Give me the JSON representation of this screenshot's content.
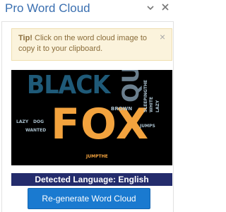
{
  "header": {
    "title": "Pro Word Cloud"
  },
  "tip": {
    "label": "Tip!",
    "text": "Click on the word cloud image to copy it to your clipboard.",
    "close": "×"
  },
  "cloud": {
    "words": {
      "black": "BLACK",
      "fox": "FOX",
      "quick": "QUICK",
      "brown": "BROWN",
      "lazy": "LAZY",
      "dog": "DOG",
      "wanted": "WANTED",
      "jumpthe": "JUMPTHE",
      "jumps": "JUMPS",
      "sleepingthe": "SLEEPINGTHE",
      "white": "WHITE",
      "small_lazy": "LAZY"
    },
    "colors": {
      "black": "#1f5a78",
      "fox": "#f3a33e",
      "quick": "#6b7f8e",
      "brown": "#a9bfcc",
      "small": "#a9bfcc",
      "jumpthe": "#f3a33e"
    }
  },
  "language": {
    "text": "Detected Language: English"
  },
  "regenerate": {
    "label": "Re-generate Word Cloud"
  }
}
